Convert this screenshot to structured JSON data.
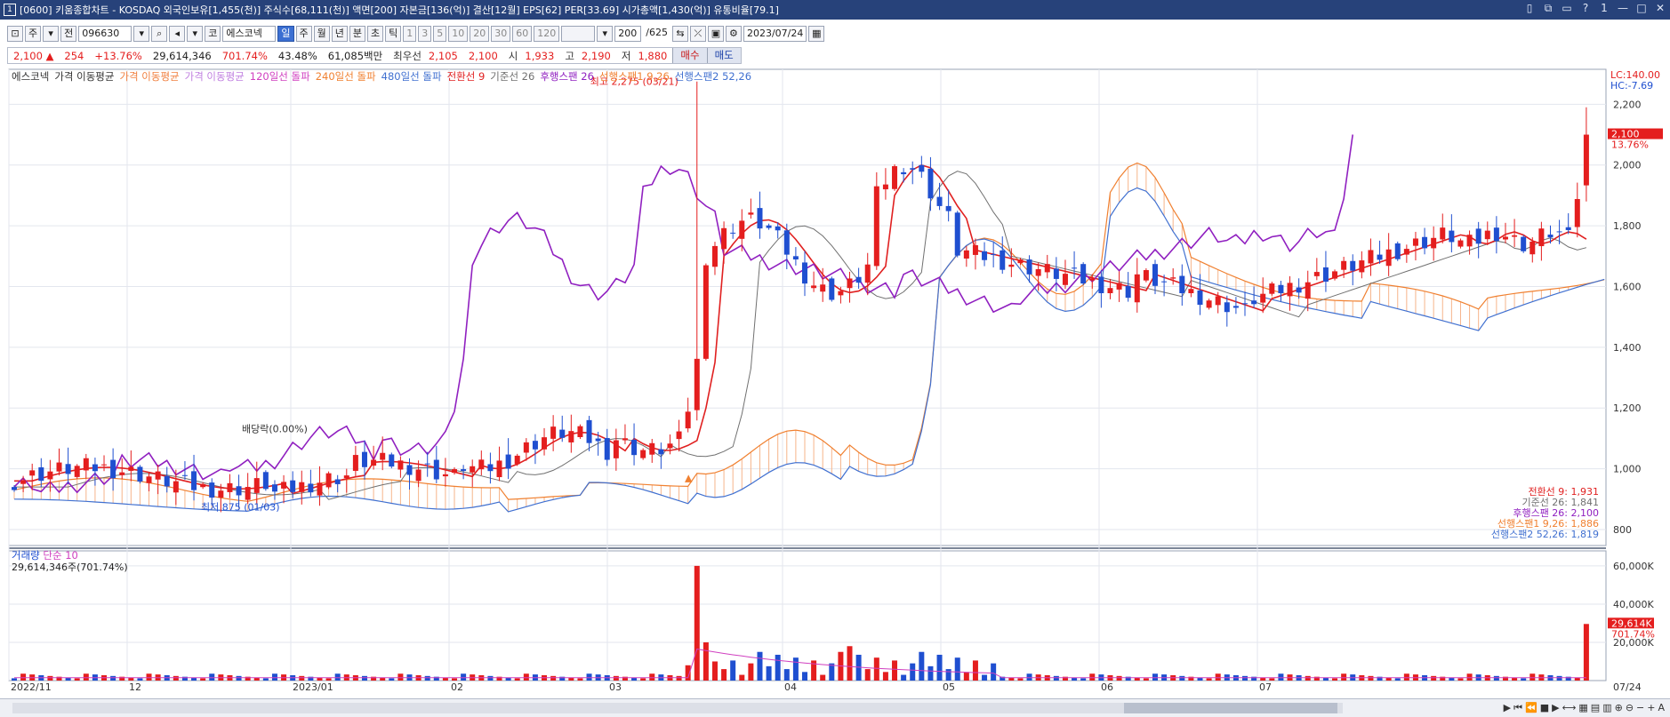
{
  "window": {
    "title": "[0600] 키움종합차트 - KOSDAQ 외국인보유[1,455(천)] 주식수[68,111(천)] 액면[200] 자본금[136(억)] 결산[12월] EPS[62] PER[33.69] 시가총액[1,430(억)] 유통비율[79.1]",
    "icon": "1",
    "controls": [
      "▯",
      "⧉",
      "▭",
      "?",
      "1",
      "—",
      "□",
      "✕"
    ]
  },
  "toolbar": {
    "items": [
      "주",
      "전"
    ],
    "code": "096630",
    "name_prefix": "코",
    "name": "에스코넥",
    "periods": [
      "일",
      "주",
      "월",
      "년",
      "분",
      "초",
      "틱"
    ],
    "active_period": "일",
    "intervals": [
      "1",
      "3",
      "5",
      "10",
      "20",
      "30",
      "60",
      "120"
    ],
    "count": "200",
    "count_total": "/625",
    "date": "2023/07/24"
  },
  "pricebar": {
    "price": "2,100 ▲",
    "change": "254",
    "change_pct": "+13.76%",
    "volume": "29,614,346",
    "volume_pct": "701.74%",
    "turnover": "43.48%",
    "amount": "61,085백만",
    "priority_label": "최우선",
    "priority_sell": "2,105",
    "priority_buy": "2,100",
    "open_label": "시",
    "open": "1,933",
    "high_label": "고",
    "high": "2,190",
    "low_label": "저",
    "low": "1,880",
    "buy_button": "매수",
    "sell_button": "매도"
  },
  "legend": {
    "items": [
      {
        "text": "에스코넥",
        "color": "#333333"
      },
      {
        "text": "가격 이동평균",
        "color": "#333333"
      },
      {
        "text": "가격 이동평균",
        "color": "#f08040"
      },
      {
        "text": "가격 이동평균",
        "color": "#c080e0"
      },
      {
        "text": "120일선 돌파",
        "color": "#d040c0"
      },
      {
        "text": "240일선 돌파",
        "color": "#f08030"
      },
      {
        "text": "480일선 돌파",
        "color": "#4070d0"
      },
      {
        "text": "전환선 9",
        "color": "#e02020"
      },
      {
        "text": "기준선 26",
        "color": "#707070"
      },
      {
        "text": "후행스팬 26",
        "color": "#9020c0"
      },
      {
        "text": "선행스팬1 9,26",
        "color": "#f08030"
      },
      {
        "text": "선행스팬2 52,26",
        "color": "#4070d0"
      }
    ]
  },
  "volume_legend": {
    "title": "거래량",
    "ma": "단순 10",
    "info": "29,614,346주(701.74%)"
  },
  "ichimoku_values": [
    {
      "text": "전환선 9: 1,931",
      "color": "#e02020"
    },
    {
      "text": "기준선 26: 1,841",
      "color": "#707070"
    },
    {
      "text": "후행스팬 26: 2,100",
      "color": "#9020c0"
    },
    {
      "text": "선행스팬1 9,26: 1,886",
      "color": "#f08030"
    },
    {
      "text": "선행스팬2 52,26: 1,819",
      "color": "#4070d0"
    }
  ],
  "chart_data": {
    "type": "candlestick",
    "y_axis_ticks": [
      "2,200",
      "2,000",
      "1,800",
      "1,600",
      "1,400",
      "1,200",
      "1,000",
      "800"
    ],
    "ylim": [
      800,
      2280
    ],
    "lc_label": "LC:140.00",
    "hc_label": "HC:-7.69",
    "current_price_tag": "2,100",
    "current_change_tag": "13.76%",
    "x_labels": [
      "2022/11",
      "12",
      "2023/01",
      "02",
      "03",
      "04",
      "05",
      "06",
      "07"
    ],
    "x_end_label": "07/24",
    "annotations": {
      "high": "최고 2,275 (03/21)",
      "low": "최저 875 (01/03)",
      "dividend": "배당락(0.00%)"
    },
    "volume_axis_ticks": [
      "60,000K",
      "40,000K",
      "20,000K"
    ],
    "volume_tag": "29,614K",
    "volume_pct_tag": "701.74%",
    "colors": {
      "up": "#e41e1e",
      "down": "#1f4fd0",
      "conv": "#e02020",
      "base": "#707070",
      "lag": "#9020c0",
      "spanA": "#f08030",
      "spanB": "#4070d0"
    }
  }
}
